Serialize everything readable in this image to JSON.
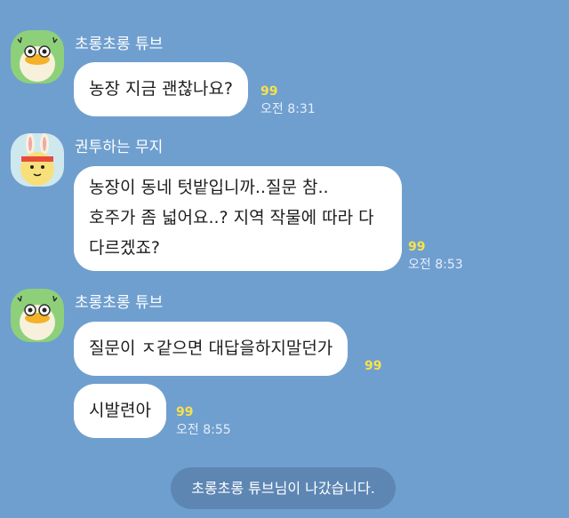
{
  "messages": [
    {
      "sender": "초롱초롱 튜브",
      "bubbles": [
        {
          "lines": [
            "농장 지금 괜찮나요?"
          ],
          "unread": "99",
          "time": "오전 8:31"
        }
      ]
    },
    {
      "sender": "권투하는 무지",
      "bubbles": [
        {
          "lines": [
            "농장이 동네 텃밭입니까..질문 참..",
            "호주가 좀 넓어요..? 지역 작물에 따라 다",
            "다르겠죠?"
          ],
          "unread": "99",
          "time": "오전 8:53"
        }
      ]
    },
    {
      "sender": "초롱초롱 튜브",
      "bubbles": [
        {
          "lines": [
            "질문이 ㅈ같으면 대답을하지말던가"
          ],
          "unread": "99"
        },
        {
          "lines": [
            "시발련아"
          ],
          "unread": "99",
          "time": "오전 8:55"
        }
      ]
    }
  ],
  "system_notice": "초롱초롱 튜브님이 나갔습니다.",
  "colors": {
    "background": "#6f9fcf",
    "bubble": "#ffffff",
    "unread": "#f6e24a",
    "notice_bg": "#5d86b3",
    "tube_avatar_bg": "#8ed07a",
    "muzi_avatar_bg": "#cfe8ee"
  },
  "icons": {
    "avatar_1": "tube-duck-avatar-icon",
    "avatar_2": "muzi-boxing-avatar-icon"
  }
}
